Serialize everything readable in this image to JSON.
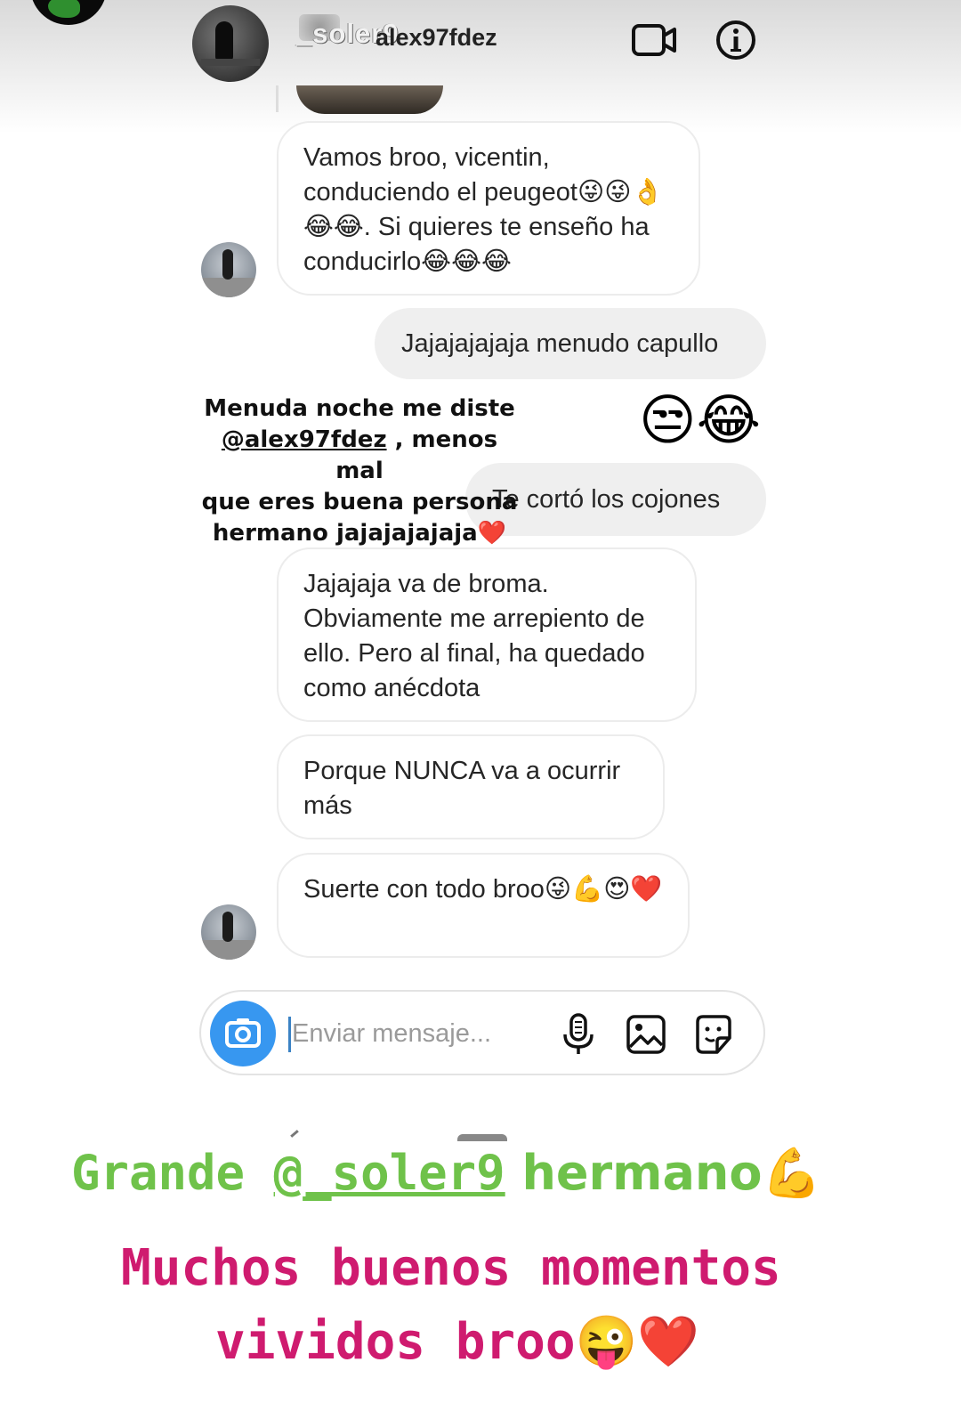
{
  "header": {
    "overlay_name": "_soler9",
    "username": "alex97fdez"
  },
  "messages": [
    {
      "side": "in",
      "text": "Vamos broo, vicentin, conduciendo el peugeot😜😜👌😂😂. Si quieres te enseño ha conducirlo😂😂😂"
    },
    {
      "side": "out",
      "text": "Jajajajajaja menudo capullo"
    },
    {
      "side": "out",
      "text": "Te cortó los cojones"
    },
    {
      "side": "in",
      "text": "Jajajaja va de broma. Obviamente me arrepiento de ello. Pero al final, ha quedado como anécdota"
    },
    {
      "side": "in",
      "text": "Porque NUNCA va a ocurrir más"
    },
    {
      "side": "in",
      "text": "Suerte con todo broo😜💪😍❤️"
    }
  ],
  "reaction_emojis": "😒😂",
  "caption": {
    "line1": "Menuda noche me diste",
    "mention": "@alex97fdez",
    "line2_rest": " , menos mal",
    "line3": "que eres buena persona",
    "line4": "hermano jajajajajaja❤️"
  },
  "composer": {
    "placeholder": "Enviar mensaje..."
  },
  "icons": [
    "video-camera-icon",
    "info-icon",
    "camera-icon",
    "microphone-icon",
    "gallery-icon",
    "sticker-icon"
  ],
  "story_text": {
    "line1_a": "Grande ",
    "line1_mention": "@_soler9",
    "line1_b": " hermano💪",
    "line2": "Muchos buenos momentos",
    "line3": "vividos broo😜❤️"
  },
  "colors": {
    "accent_blue": "#3797f0",
    "story_green": "#6fc24a",
    "story_pink": "#cf1b6f"
  }
}
